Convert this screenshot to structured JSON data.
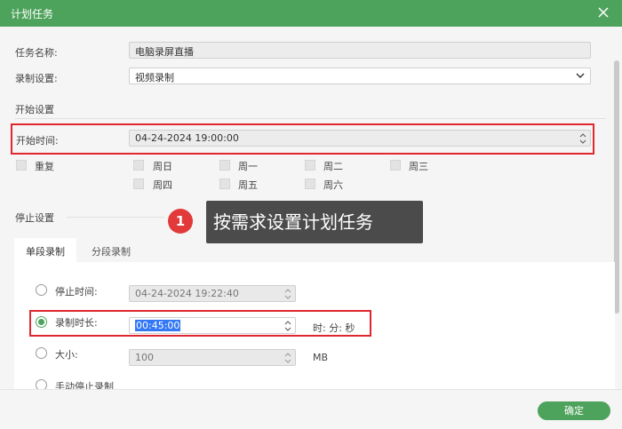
{
  "window": {
    "title": "计划任务"
  },
  "task_name": {
    "label": "任务名称:",
    "value": "电脑录屏直播"
  },
  "record_setting": {
    "label": "录制设置:",
    "value": "视频录制"
  },
  "start_section": {
    "title": "开始设置"
  },
  "start_time": {
    "label": "开始时间:",
    "value": "04-24-2024 19:00:00"
  },
  "repeat": {
    "label": "重复",
    "days": [
      "周日",
      "周一",
      "周二",
      "周三",
      "周四",
      "周五",
      "周六"
    ]
  },
  "callout": {
    "number": "1",
    "text": "按需求设置计划任务"
  },
  "stop_section": {
    "title": "停止设置"
  },
  "tabs": [
    "单段录制",
    "分段录制"
  ],
  "stop_time": {
    "label": "停止时间:",
    "value": "04-24-2024 19:22:40"
  },
  "duration": {
    "label": "录制时长:",
    "value": "00:45:00",
    "unit": "时: 分: 秒"
  },
  "size": {
    "label": "大小:",
    "value": "100",
    "unit": "MB"
  },
  "manual": {
    "label": "手动停止录制"
  },
  "footer": {
    "ok_label": "确定"
  },
  "colors": {
    "titlebar": "#4ea35c",
    "highlight": "#e0272f",
    "accent": "#4ea35c"
  }
}
